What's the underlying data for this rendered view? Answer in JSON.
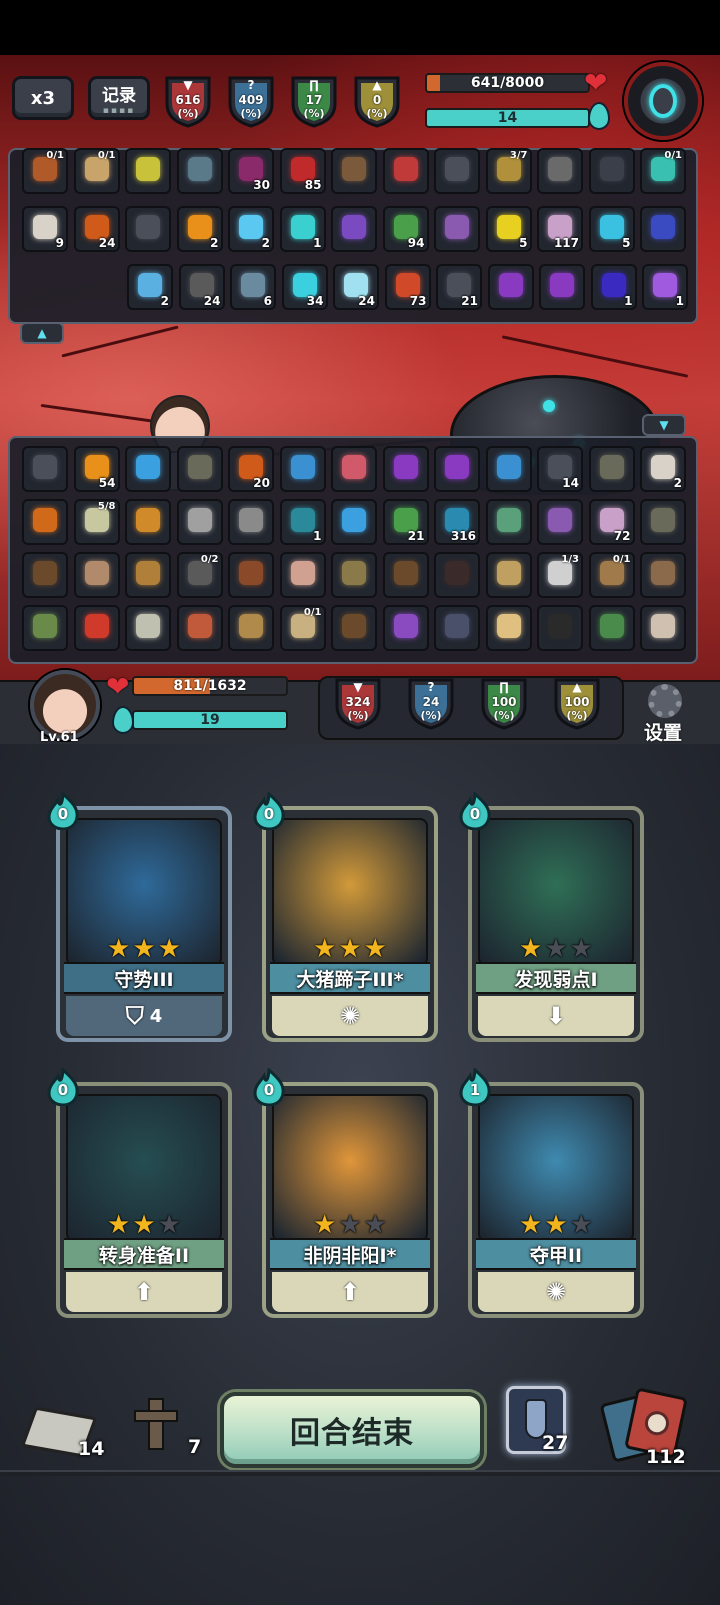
{
  "top_controls": {
    "speed_label": "x3",
    "log_label": "记录"
  },
  "enemy_stats": [
    {
      "icon": "attack-sword-icon",
      "value": "616",
      "unit": "(%)",
      "color": "#c23a3a"
    },
    {
      "icon": "question-mark-icon",
      "value": "409",
      "unit": "(%)",
      "color": "#3f7da8"
    },
    {
      "icon": "defense-gate-icon",
      "value": "17",
      "unit": "(%)",
      "color": "#3f9a4a"
    },
    {
      "icon": "arrow-up-icon",
      "value": "0",
      "unit": "(%)",
      "color": "#b3a23a"
    }
  ],
  "enemy": {
    "hp_text": "641/8000",
    "hp_current": 641,
    "hp_max": 8000,
    "energy_text": "14"
  },
  "enemy_buffs": {
    "row1": [
      {
        "count": "",
        "frac": "0/1",
        "color": "#b05a2a"
      },
      {
        "count": "",
        "frac": "0/1",
        "color": "#c8a36a"
      },
      {
        "count": "",
        "frac": "",
        "color": "#c8c23a"
      },
      {
        "count": "",
        "frac": "",
        "color": "#5a7a8a"
      },
      {
        "count": "30",
        "frac": "",
        "color": "#8a2a6a"
      },
      {
        "count": "85",
        "frac": "",
        "color": "#c02a2a"
      },
      {
        "count": "",
        "frac": "",
        "color": "#7a5a3a"
      },
      {
        "count": "",
        "frac": "",
        "color": "#c03a3a"
      },
      {
        "count": "",
        "frac": "",
        "color": "#4a4f5a"
      },
      {
        "count": "",
        "frac": "3/7",
        "color": "#b0903a"
      },
      {
        "count": "",
        "frac": "",
        "color": "#6a6a6a"
      },
      {
        "count": "",
        "frac": "",
        "color": "#3a3f4a"
      },
      {
        "count": "",
        "frac": "0/1",
        "color": "#3ac0b0"
      }
    ],
    "row2": [
      {
        "count": "9",
        "frac": "",
        "color": "#d8d2c8"
      },
      {
        "count": "24",
        "frac": "",
        "color": "#d05a1a"
      },
      {
        "count": "",
        "frac": "",
        "color": "#4a4f5a"
      },
      {
        "count": "2",
        "frac": "",
        "color": "#e8901a"
      },
      {
        "count": "2",
        "frac": "",
        "color": "#5ac8f0"
      },
      {
        "count": "1",
        "frac": "",
        "color": "#3ad0d0"
      },
      {
        "count": "",
        "frac": "",
        "color": "#7a4ac0"
      },
      {
        "count": "94",
        "frac": "",
        "color": "#4aa04a"
      },
      {
        "count": "",
        "frac": "",
        "color": "#8a5ab0"
      },
      {
        "count": "5",
        "frac": "",
        "color": "#e8d020"
      },
      {
        "count": "117",
        "frac": "",
        "color": "#c8a0c8"
      },
      {
        "count": "5",
        "frac": "",
        "color": "#3ac0e0"
      },
      {
        "count": "",
        "frac": "",
        "color": "#3a4ac0"
      }
    ],
    "row3": [
      {
        "count": "2",
        "frac": "",
        "color": "#5ab0e0"
      },
      {
        "count": "24",
        "frac": "",
        "color": "#5a5a5a"
      },
      {
        "count": "6",
        "frac": "",
        "color": "#6a8aa0"
      },
      {
        "count": "34",
        "frac": "",
        "color": "#3ad0e0"
      },
      {
        "count": "24",
        "frac": "",
        "color": "#a0e0f0"
      },
      {
        "count": "73",
        "frac": "",
        "color": "#d04a2a"
      },
      {
        "count": "21",
        "frac": "",
        "color": "#4a4f5a"
      },
      {
        "count": "",
        "frac": "",
        "color": "#8a3ac0"
      },
      {
        "count": "",
        "frac": "",
        "color": "#8a3ac0"
      },
      {
        "count": "1",
        "frac": "",
        "color": "#3a2ac0"
      },
      {
        "count": "1",
        "frac": "",
        "color": "#a05ae0"
      }
    ]
  },
  "player_buffs": {
    "row1": [
      {
        "count": "",
        "frac": "",
        "color": "#4a4f5a"
      },
      {
        "count": "54",
        "frac": "",
        "color": "#e8901a"
      },
      {
        "count": "",
        "frac": "",
        "color": "#3aa0e0"
      },
      {
        "count": "",
        "frac": "",
        "color": "#6a6a5a"
      },
      {
        "count": "20",
        "frac": "",
        "color": "#d05a1a"
      },
      {
        "count": "",
        "frac": "",
        "color": "#3a90d0"
      },
      {
        "count": "",
        "frac": "",
        "color": "#d05a6a"
      },
      {
        "count": "",
        "frac": "",
        "color": "#8a3ac0"
      },
      {
        "count": "",
        "frac": "",
        "color": "#8a3ac0"
      },
      {
        "count": "",
        "frac": "",
        "color": "#3a90d0"
      },
      {
        "count": "14",
        "frac": "",
        "color": "#4a4f5a"
      },
      {
        "count": "",
        "frac": "",
        "color": "#6a6a5a"
      },
      {
        "count": "2",
        "frac": "",
        "color": "#d8d2c8"
      }
    ],
    "row2": [
      {
        "count": "",
        "frac": "",
        "color": "#d06a1a"
      },
      {
        "count": "",
        "frac": "5/8",
        "color": "#c8c8a0"
      },
      {
        "count": "",
        "frac": "",
        "color": "#d08a2a"
      },
      {
        "count": "",
        "frac": "",
        "color": "#a0a0a0"
      },
      {
        "count": "",
        "frac": "",
        "color": "#8a8a8a"
      },
      {
        "count": "1",
        "frac": "",
        "color": "#2a8a9a"
      },
      {
        "count": "",
        "frac": "",
        "color": "#3aa0e0"
      },
      {
        "count": "21",
        "frac": "",
        "color": "#4aa04a"
      },
      {
        "count": "316",
        "frac": "",
        "color": "#2a8ab0"
      },
      {
        "count": "",
        "frac": "",
        "color": "#5aa07a"
      },
      {
        "count": "",
        "frac": "",
        "color": "#8a5ab0"
      },
      {
        "count": "72",
        "frac": "",
        "color": "#c8a0c8"
      },
      {
        "count": "",
        "frac": "",
        "color": "#6a6a5a"
      }
    ],
    "row3": [
      {
        "count": "",
        "frac": "",
        "color": "#6a4a2a"
      },
      {
        "count": "",
        "frac": "",
        "color": "#b08a6a"
      },
      {
        "count": "",
        "frac": "",
        "color": "#b0803a"
      },
      {
        "count": "",
        "frac": "0/2",
        "color": "#5a5a5a"
      },
      {
        "count": "",
        "frac": "",
        "color": "#8a4a2a"
      },
      {
        "count": "",
        "frac": "",
        "color": "#d0a090"
      },
      {
        "count": "",
        "frac": "",
        "color": "#8a7a4a"
      },
      {
        "count": "",
        "frac": "",
        "color": "#6a4a2a"
      },
      {
        "count": "",
        "frac": "",
        "color": "#3a2a2a"
      },
      {
        "count": "",
        "frac": "",
        "color": "#c0a060"
      },
      {
        "count": "",
        "frac": "1/3",
        "color": "#d0d0d0"
      },
      {
        "count": "",
        "frac": "0/1",
        "color": "#a07a4a"
      },
      {
        "count": "",
        "frac": "",
        "color": "#8a6a4a"
      }
    ],
    "row4": [
      {
        "count": "",
        "frac": "",
        "color": "#6a8a4a"
      },
      {
        "count": "",
        "frac": "",
        "color": "#d03a2a"
      },
      {
        "count": "",
        "frac": "",
        "color": "#c0c0b0"
      },
      {
        "count": "",
        "frac": "",
        "color": "#c05a3a"
      },
      {
        "count": "",
        "frac": "",
        "color": "#b08a4a"
      },
      {
        "count": "",
        "frac": "0/1",
        "color": "#c8b080"
      },
      {
        "count": "",
        "frac": "",
        "color": "#6a4a2a"
      },
      {
        "count": "",
        "frac": "",
        "color": "#8a4ac0"
      },
      {
        "count": "",
        "frac": "",
        "color": "#4a4f6a"
      },
      {
        "count": "",
        "frac": "",
        "color": "#e0c080"
      },
      {
        "count": "",
        "frac": "",
        "color": "#2a2a2a"
      },
      {
        "count": "",
        "frac": "",
        "color": "#4a8a4a"
      },
      {
        "count": "",
        "frac": "",
        "color": "#d0c0b0"
      }
    ]
  },
  "player": {
    "level": "Lv.61",
    "hp_text": "811/1632",
    "hp_current": 811,
    "hp_max": 1632,
    "energy_text": "19"
  },
  "player_stats": [
    {
      "icon": "attack-sword-icon",
      "value": "324",
      "unit": "(%)",
      "color": "#c23a3a"
    },
    {
      "icon": "question-mark-icon",
      "value": "24",
      "unit": "(%)",
      "color": "#3f7da8"
    },
    {
      "icon": "defense-gate-icon",
      "value": "100",
      "unit": "(%)",
      "color": "#3f9a4a"
    },
    {
      "icon": "arrow-up-icon",
      "value": "100",
      "unit": "(%)",
      "color": "#b3a23a"
    }
  ],
  "settings_label": "设置",
  "cards": [
    {
      "name": "守势III",
      "cost": "0",
      "stars": 3,
      "foot_value": "4",
      "foot_icon": "shield-icon",
      "border": "#7f93a8",
      "name_bg": "#3e6f86",
      "foot_bg": "#51677a",
      "art_bg": "#2f6a9a"
    },
    {
      "name": "大猪蹄子III*",
      "cost": "0",
      "stars": 3,
      "foot_value": "",
      "foot_icon": "whistle-icon",
      "border": "#9aa184",
      "name_bg": "#4d8ea0",
      "foot_bg": "#d9d7b8",
      "art_bg": "#d29a3a"
    },
    {
      "name": "发现弱点I",
      "cost": "0",
      "stars": 1,
      "foot_value": "",
      "foot_icon": "arrow-down-icon",
      "border": "#8a8f7a",
      "name_bg": "#6fa083",
      "foot_bg": "#d9d7b8",
      "art_bg": "#2f6f56"
    },
    {
      "name": "转身准备II",
      "cost": "0",
      "stars": 2,
      "foot_value": "",
      "foot_icon": "arrow-up-icon",
      "border": "#8a8f7a",
      "name_bg": "#6fa083",
      "foot_bg": "#d9d7b8",
      "art_bg": "#254e52"
    },
    {
      "name": "非阴非阳I*",
      "cost": "0",
      "stars": 1,
      "foot_value": "",
      "foot_icon": "arrow-up-icon",
      "border": "#9aa184",
      "name_bg": "#4d8ea0",
      "foot_bg": "#d9d7b8",
      "art_bg": "#e0963a"
    },
    {
      "name": "夺甲II",
      "cost": "1",
      "stars": 2,
      "foot_value": "",
      "foot_icon": "whistle-icon",
      "border": "#8a8f7a",
      "name_bg": "#4d8ea0",
      "foot_bg": "#d9d7b8",
      "art_bg": "#3f8ab0"
    }
  ],
  "bottom": {
    "draw_pile_count": "14",
    "discard_pile_count": "7",
    "end_turn_label": "回合结束",
    "potion_count": "27",
    "deck_count": "112"
  }
}
